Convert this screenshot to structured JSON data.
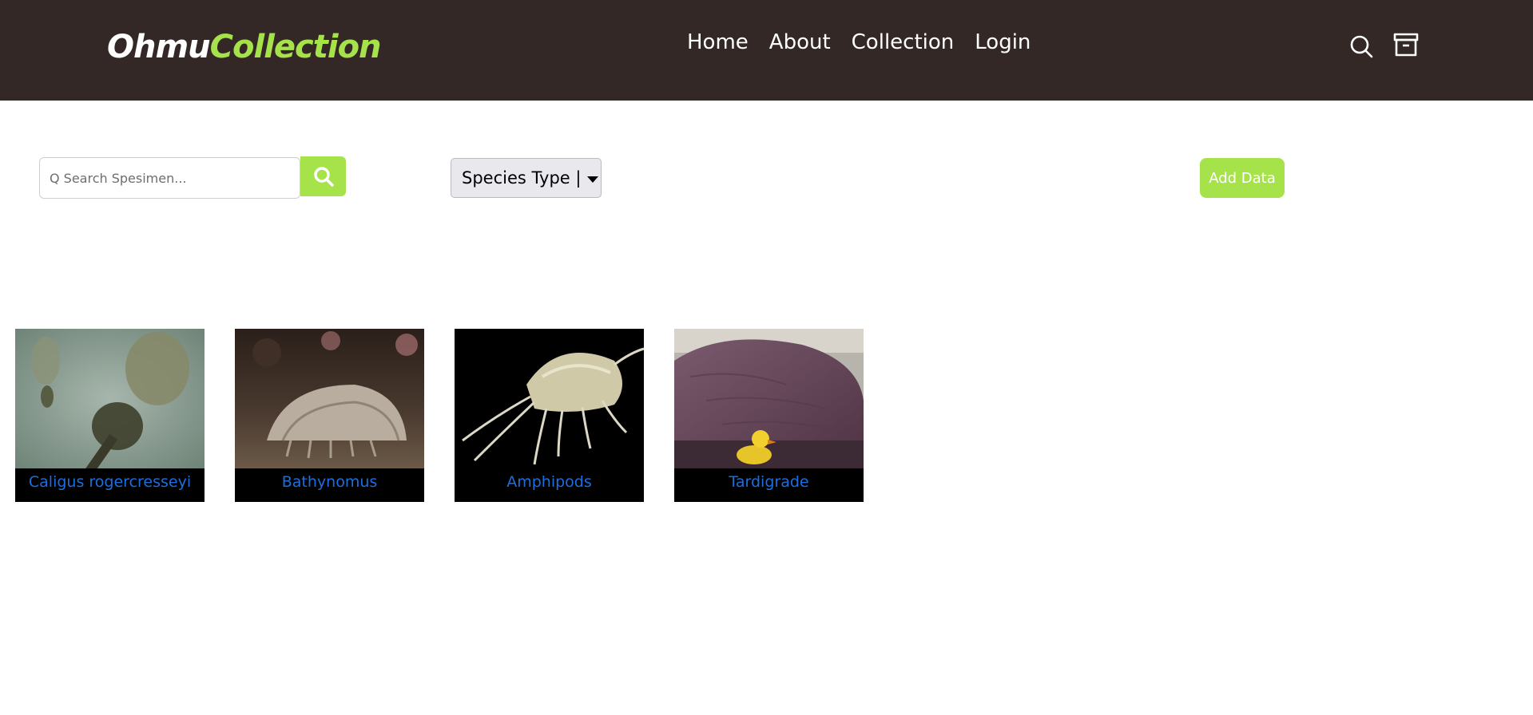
{
  "header": {
    "logo_part1": "Ohmu",
    "logo_part2": "Collection",
    "nav": [
      "Home",
      "About",
      "Collection",
      "Login"
    ],
    "icons": [
      "search-icon",
      "archive-icon"
    ]
  },
  "toolbar": {
    "search_placeholder": "Q Search Spesimen...",
    "search_value": "",
    "species_dropdown_label": "Species Type |",
    "add_button_label": "Add Data"
  },
  "specimens": [
    {
      "name": "Caligus rogercresseyi"
    },
    {
      "name": "Bathynomus"
    },
    {
      "name": "Amphipods"
    },
    {
      "name": "Tardigrade"
    }
  ],
  "colors": {
    "navbar_bg": "#342826",
    "accent": "#a6e34a",
    "link_blue": "#1a6fe0"
  }
}
